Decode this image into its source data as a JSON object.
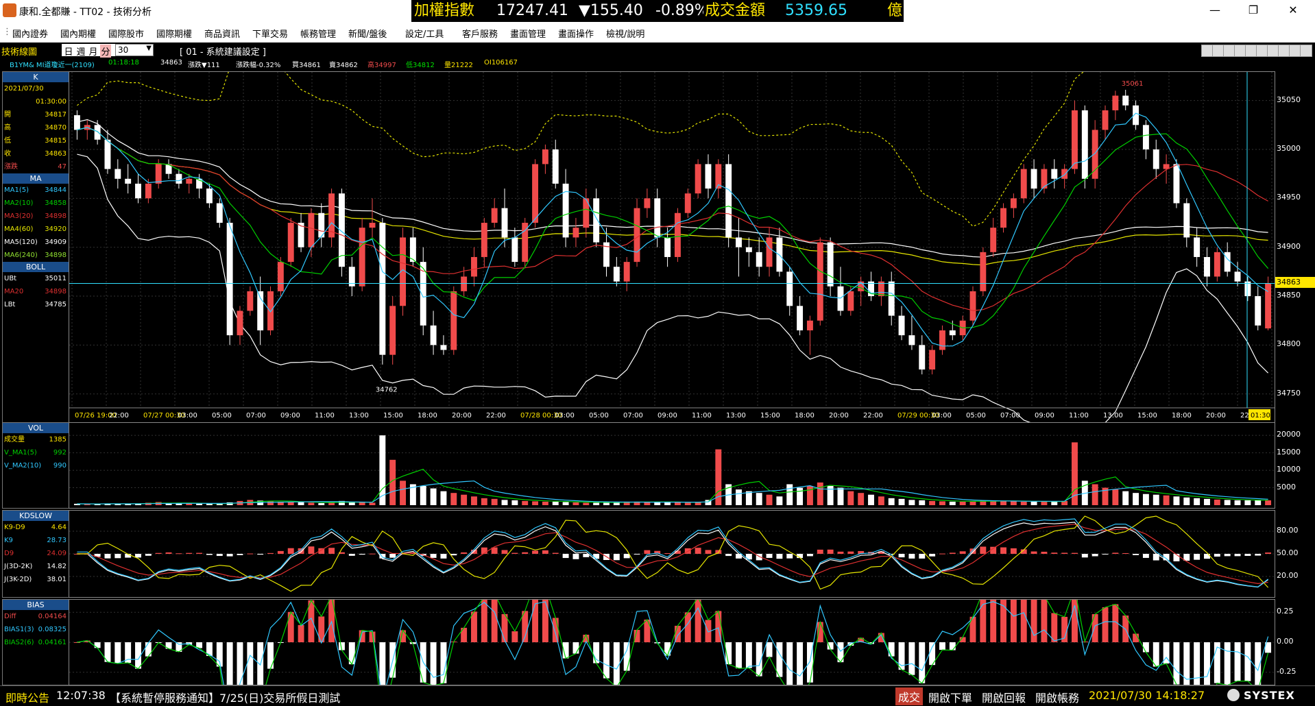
{
  "window": {
    "title": "康和.全都賺 - TT02 - 技術分析",
    "minimize": "—",
    "restore": "❐",
    "close": "✕"
  },
  "ticker": {
    "index_label": "加權指數",
    "index_value": "17247.41",
    "change": "▼155.40",
    "change_pct": "-0.89%",
    "volume_label": "成交金額",
    "volume_value": "5359.65",
    "volume_unit": "億"
  },
  "menu": [
    "國內證券",
    "國內期權",
    "國際股市",
    "國際期權",
    "商品資訊",
    "下單交易",
    "帳務管理",
    "新聞/盤後",
    "設定/工具",
    "客戶服務",
    "畫面管理",
    "畫面操作",
    "檢視/說明"
  ],
  "toolbar": {
    "title": "技術線圖",
    "periods": [
      "日",
      "週",
      "月",
      "分"
    ],
    "active_period": "分",
    "interval": "30",
    "setting": "[ 01 - 系統建議設定 ]"
  },
  "quote_line": {
    "symbol": "B1YM&  MI道瓊近一(2109)",
    "time": "01:18:18",
    "price": "34863",
    "change": "漲跌▼111",
    "change_pct": "漲跌幅-0.32%",
    "bid": "買34861",
    "ask": "賣34862",
    "high": "高34997",
    "low": "低34812",
    "vol": "量21222",
    "oi": "OI106167"
  },
  "colors": {
    "up": "#f04b4b",
    "down": "#ffffff",
    "ma5": "#30c8ff",
    "ma10": "#00d000",
    "ma20": "#e03030",
    "ma60": "#e6e600",
    "ma120": "#ffffff",
    "ma240": "#90e030",
    "grid": "#333333",
    "accent": "#ffff00"
  },
  "k_panel": {
    "head": "K",
    "date": "2021/07/30",
    "time": "01:30:00",
    "rows": [
      {
        "k": "開",
        "v": "34817"
      },
      {
        "k": "高",
        "v": "34870"
      },
      {
        "k": "低",
        "v": "34815"
      },
      {
        "k": "收",
        "v": "34863"
      },
      {
        "k": "漲跌",
        "v": "47"
      }
    ]
  },
  "ma_panel": {
    "head": "MA",
    "rows": [
      {
        "k": "MA1(5)",
        "v": "34844"
      },
      {
        "k": "MA2(10)",
        "v": "34858"
      },
      {
        "k": "MA3(20)",
        "v": "34898"
      },
      {
        "k": "MA4(60)",
        "v": "34920"
      },
      {
        "k": "MA5(120)",
        "v": "34909"
      },
      {
        "k": "MA6(240)",
        "v": "34898"
      }
    ]
  },
  "boll_panel": {
    "head": "BOLL",
    "rows": [
      {
        "k": "UBt",
        "v": "35011"
      },
      {
        "k": "MA20",
        "v": "34898"
      },
      {
        "k": "LBt",
        "v": "34785"
      }
    ]
  },
  "vol_panel": {
    "head": "VOL",
    "rows": [
      {
        "k": "成交量",
        "v": "1385"
      },
      {
        "k": "V_MA1(5)",
        "v": "992"
      },
      {
        "k": "V_MA2(10)",
        "v": "990"
      }
    ]
  },
  "kd_panel": {
    "head": "KDSLOW",
    "rows": [
      {
        "k": "K9-D9",
        "v": "4.64"
      },
      {
        "k": "K9",
        "v": "28.73"
      },
      {
        "k": "D9",
        "v": "24.09"
      },
      {
        "k": "J(3D-2K)",
        "v": "14.82"
      },
      {
        "k": "J(3K-2D)",
        "v": "38.01"
      }
    ]
  },
  "bias_panel": {
    "head": "BIAS",
    "rows": [
      {
        "k": "Diff",
        "v": "0.04164"
      },
      {
        "k": "BIAS1(3)",
        "v": "0.08325"
      },
      {
        "k": "BIAS2(6)",
        "v": "0.04161"
      }
    ]
  },
  "price_axis": [
    "35050",
    "35000",
    "34950",
    "34900",
    "34850",
    "34800",
    "34750"
  ],
  "current_price": "34863",
  "high_mark": "35061",
  "low_mark": "34762",
  "vol_axis": [
    "20000",
    "15000",
    "10000",
    "5000"
  ],
  "kd_axis": [
    "80.00",
    "50.00",
    "20.00"
  ],
  "bias_axis": [
    "0.25",
    "0.00",
    "-0.25"
  ],
  "time_axis": [
    {
      "t": "07/26 19:00",
      "d": true
    },
    {
      "t": "22:00"
    },
    {
      "t": "07/27 00:30",
      "d": true
    },
    {
      "t": "03:00"
    },
    {
      "t": "05:00"
    },
    {
      "t": "07:00"
    },
    {
      "t": "09:00"
    },
    {
      "t": "11:00"
    },
    {
      "t": "13:00"
    },
    {
      "t": "15:00"
    },
    {
      "t": "18:00"
    },
    {
      "t": "20:00"
    },
    {
      "t": "22:00"
    },
    {
      "t": "07/28 00:30",
      "d": true
    },
    {
      "t": "03:00"
    },
    {
      "t": "05:00"
    },
    {
      "t": "07:00"
    },
    {
      "t": "09:00"
    },
    {
      "t": "11:00"
    },
    {
      "t": "13:00"
    },
    {
      "t": "15:00"
    },
    {
      "t": "18:00"
    },
    {
      "t": "20:00"
    },
    {
      "t": "22:00"
    },
    {
      "t": "07/29 00:30",
      "d": true
    },
    {
      "t": "03:00"
    },
    {
      "t": "05:00"
    },
    {
      "t": "07:00"
    },
    {
      "t": "09:00"
    },
    {
      "t": "11:00"
    },
    {
      "t": "13:00"
    },
    {
      "t": "15:00"
    },
    {
      "t": "18:00"
    },
    {
      "t": "20:00"
    },
    {
      "t": "22:00"
    }
  ],
  "cursor_time": "01:30",
  "chart_data": {
    "type": "candlestick",
    "ylim": [
      34740,
      35075
    ],
    "bars": [
      [
        35035,
        35040,
        35010,
        35020,
        400
      ],
      [
        35020,
        35030,
        35010,
        35025,
        350
      ],
      [
        35025,
        35030,
        35005,
        35010,
        300
      ],
      [
        35010,
        35020,
        34975,
        34980,
        500
      ],
      [
        34980,
        34990,
        34960,
        34970,
        450
      ],
      [
        34970,
        34985,
        34955,
        34965,
        400
      ],
      [
        34965,
        34975,
        34945,
        34950,
        380
      ],
      [
        34950,
        34970,
        34945,
        34965,
        700
      ],
      [
        34965,
        34990,
        34960,
        34985,
        900
      ],
      [
        34985,
        34990,
        34970,
        34975,
        600
      ],
      [
        34975,
        34980,
        34960,
        34965,
        500
      ],
      [
        34965,
        34975,
        34955,
        34970,
        450
      ],
      [
        34970,
        34975,
        34950,
        34960,
        400
      ],
      [
        34960,
        34965,
        34940,
        34945,
        420
      ],
      [
        34945,
        34950,
        34920,
        34925,
        430
      ],
      [
        34925,
        34930,
        34800,
        34810,
        800
      ],
      [
        34810,
        34840,
        34800,
        34835,
        1200
      ],
      [
        34835,
        34860,
        34830,
        34855,
        1500
      ],
      [
        34855,
        34870,
        34800,
        34815,
        1300
      ],
      [
        34815,
        34860,
        34810,
        34855,
        1100
      ],
      [
        34855,
        34890,
        34850,
        34885,
        1000
      ],
      [
        34885,
        34930,
        34880,
        34925,
        900
      ],
      [
        34925,
        34935,
        34895,
        34900,
        850
      ],
      [
        34900,
        34940,
        34890,
        34935,
        700
      ],
      [
        34935,
        34945,
        34900,
        34910,
        600
      ],
      [
        34910,
        34960,
        34900,
        34955,
        800
      ],
      [
        34955,
        34960,
        34870,
        34880,
        1200
      ],
      [
        34880,
        34890,
        34850,
        34860,
        900
      ],
      [
        34860,
        34930,
        34855,
        34920,
        800
      ],
      [
        34920,
        34950,
        34910,
        34925,
        700
      ],
      [
        34925,
        34930,
        34780,
        34790,
        20000
      ],
      [
        34790,
        34850,
        34780,
        34840,
        13000
      ],
      [
        34840,
        34920,
        34830,
        34910,
        7000
      ],
      [
        34910,
        34920,
        34880,
        34885,
        6000
      ],
      [
        34885,
        34900,
        34810,
        34820,
        5500
      ],
      [
        34820,
        34835,
        34790,
        34800,
        4800
      ],
      [
        34800,
        34810,
        34790,
        34795,
        4000
      ],
      [
        34795,
        34860,
        34790,
        34855,
        3500
      ],
      [
        34855,
        34880,
        34850,
        34870,
        3000
      ],
      [
        34870,
        34900,
        34860,
        34890,
        2500
      ],
      [
        34890,
        34930,
        34880,
        34925,
        2000
      ],
      [
        34925,
        34950,
        34920,
        34940,
        1800
      ],
      [
        34940,
        34960,
        34900,
        34910,
        1500
      ],
      [
        34910,
        34920,
        34880,
        34885,
        1400
      ],
      [
        34885,
        34930,
        34880,
        34925,
        1200
      ],
      [
        34925,
        34990,
        34920,
        34985,
        1100
      ],
      [
        34985,
        35005,
        34975,
        35000,
        1000
      ],
      [
        35000,
        35010,
        34960,
        34965,
        1000
      ],
      [
        34965,
        34980,
        34900,
        34910,
        900
      ],
      [
        34910,
        34930,
        34900,
        34920,
        800
      ],
      [
        34920,
        34960,
        34910,
        34950,
        700
      ],
      [
        34950,
        34960,
        34900,
        34905,
        700
      ],
      [
        34905,
        34920,
        34870,
        34880,
        800
      ],
      [
        34880,
        34890,
        34860,
        34865,
        900
      ],
      [
        34865,
        34890,
        34855,
        34885,
        1000
      ],
      [
        34885,
        34950,
        34880,
        34940,
        1000
      ],
      [
        34940,
        34960,
        34930,
        34950,
        900
      ],
      [
        34950,
        34960,
        34900,
        34910,
        900
      ],
      [
        34910,
        34920,
        34880,
        34890,
        900
      ],
      [
        34890,
        34940,
        34885,
        34935,
        800
      ],
      [
        34935,
        34960,
        34930,
        34955,
        700
      ],
      [
        34955,
        34990,
        34950,
        34985,
        800
      ],
      [
        34985,
        34995,
        34950,
        34960,
        1500
      ],
      [
        34960,
        34990,
        34950,
        34985,
        16000
      ],
      [
        34985,
        34995,
        34900,
        34910,
        6000
      ],
      [
        34910,
        34930,
        34870,
        34900,
        4500
      ],
      [
        34900,
        34910,
        34880,
        34895,
        4000
      ],
      [
        34895,
        34910,
        34870,
        34880,
        3500
      ],
      [
        34880,
        34920,
        34870,
        34910,
        3000
      ],
      [
        34910,
        34920,
        34870,
        34875,
        2500
      ],
      [
        34875,
        34880,
        34830,
        34840,
        6000
      ],
      [
        34840,
        34850,
        34810,
        34815,
        5000
      ],
      [
        34815,
        34830,
        34790,
        34825,
        5500
      ],
      [
        34825,
        34910,
        34820,
        34905,
        6500
      ],
      [
        34905,
        34910,
        34850,
        34860,
        5500
      ],
      [
        34860,
        34880,
        34830,
        34835,
        5000
      ],
      [
        34835,
        34860,
        34830,
        34855,
        4000
      ],
      [
        34855,
        34870,
        34840,
        34865,
        3500
      ],
      [
        34865,
        34875,
        34845,
        34850,
        3000
      ],
      [
        34850,
        34870,
        34840,
        34865,
        2500
      ],
      [
        34865,
        34875,
        34820,
        34830,
        2000
      ],
      [
        34830,
        34840,
        34805,
        34810,
        1800
      ],
      [
        34810,
        34830,
        34795,
        34800,
        1500
      ],
      [
        34800,
        34810,
        34770,
        34775,
        1400
      ],
      [
        34775,
        34800,
        34770,
        34795,
        1200
      ],
      [
        34795,
        34820,
        34790,
        34815,
        1100
      ],
      [
        34815,
        34825,
        34805,
        34810,
        1000
      ],
      [
        34810,
        34830,
        34805,
        34825,
        1000
      ],
      [
        34825,
        34860,
        34820,
        34855,
        1200
      ],
      [
        34855,
        34900,
        34850,
        34895,
        1300
      ],
      [
        34895,
        34930,
        34890,
        34920,
        1300
      ],
      [
        34920,
        34945,
        34915,
        34940,
        1200
      ],
      [
        34940,
        34955,
        34930,
        34950,
        1100
      ],
      [
        34950,
        34985,
        34945,
        34980,
        1000
      ],
      [
        34980,
        34990,
        34950,
        34960,
        1000
      ],
      [
        34960,
        34985,
        34955,
        34980,
        1100
      ],
      [
        34980,
        34990,
        34960,
        34970,
        1000
      ],
      [
        34970,
        34985,
        34960,
        34980,
        1200
      ],
      [
        34980,
        35050,
        34975,
        35040,
        18000
      ],
      [
        35040,
        35045,
        34960,
        34970,
        7000
      ],
      [
        34970,
        35030,
        34960,
        35020,
        6000
      ],
      [
        35020,
        35045,
        35010,
        35040,
        5000
      ],
      [
        35040,
        35060,
        35030,
        35055,
        4500
      ],
      [
        35055,
        35061,
        35040,
        35045,
        4000
      ],
      [
        35045,
        35050,
        35020,
        35025,
        3500
      ],
      [
        35025,
        35030,
        34990,
        35000,
        3200
      ],
      [
        35000,
        35010,
        34970,
        34980,
        3000
      ],
      [
        34980,
        34995,
        34965,
        34985,
        2800
      ],
      [
        34985,
        34990,
        34940,
        34945,
        2500
      ],
      [
        34945,
        34950,
        34900,
        34910,
        2200
      ],
      [
        34910,
        34920,
        34880,
        34890,
        2000
      ],
      [
        34890,
        34900,
        34860,
        34870,
        1800
      ],
      [
        34870,
        34900,
        34865,
        34895,
        1600
      ],
      [
        34895,
        34905,
        34870,
        34875,
        1500
      ],
      [
        34875,
        34885,
        34860,
        34865,
        1400
      ],
      [
        34865,
        34870,
        34845,
        34850,
        1400
      ],
      [
        34850,
        34860,
        34815,
        34820,
        1400
      ],
      [
        34817,
        34870,
        34815,
        34863,
        1385
      ]
    ]
  }
}
